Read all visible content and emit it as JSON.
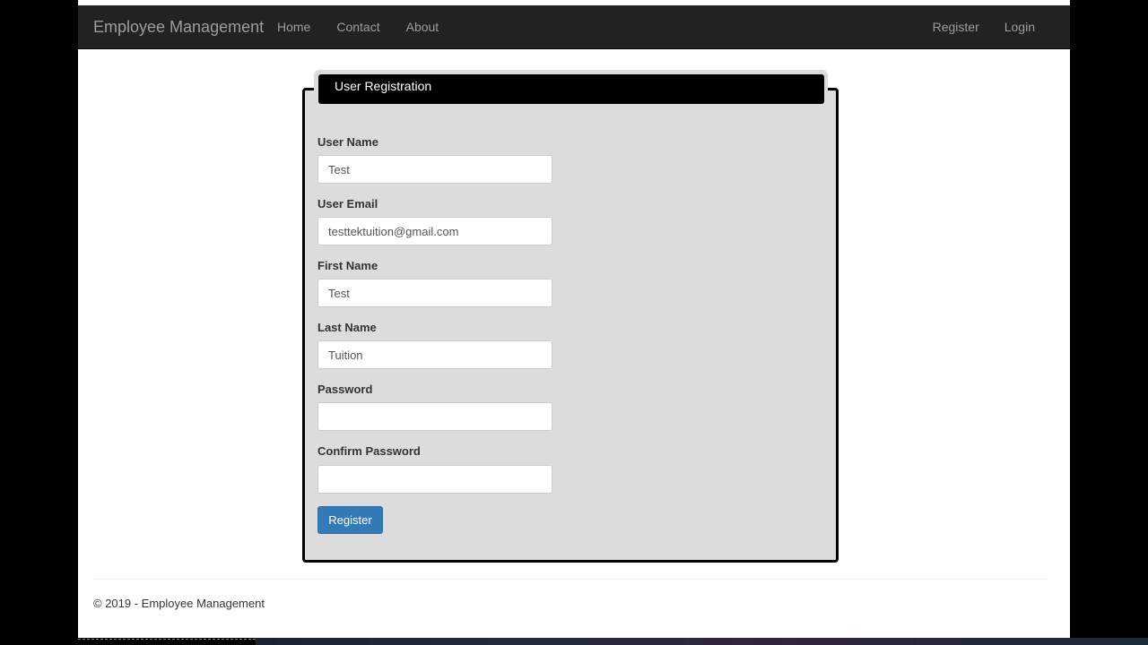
{
  "navbar": {
    "brand": "Employee Management",
    "left_links": [
      "Home",
      "Contact",
      "About"
    ],
    "right_links": [
      "Register",
      "Login"
    ]
  },
  "form": {
    "legend": "User Registration",
    "fields": [
      {
        "label": "User Name",
        "value": "Test"
      },
      {
        "label": "User Email",
        "value": "testtektuition@gmail.com"
      },
      {
        "label": "First Name",
        "value": "Test"
      },
      {
        "label": "Last Name",
        "value": "Tuition"
      },
      {
        "label": "Password",
        "value": ""
      },
      {
        "label": "Confirm Password",
        "value": ""
      }
    ],
    "submit_label": "Register"
  },
  "footer": {
    "text": "© 2019 - Employee Management"
  },
  "colors": {
    "navbar_bg": "#222222",
    "fieldset_bg": "#dcdcdc",
    "primary_button": "#337ab7"
  }
}
